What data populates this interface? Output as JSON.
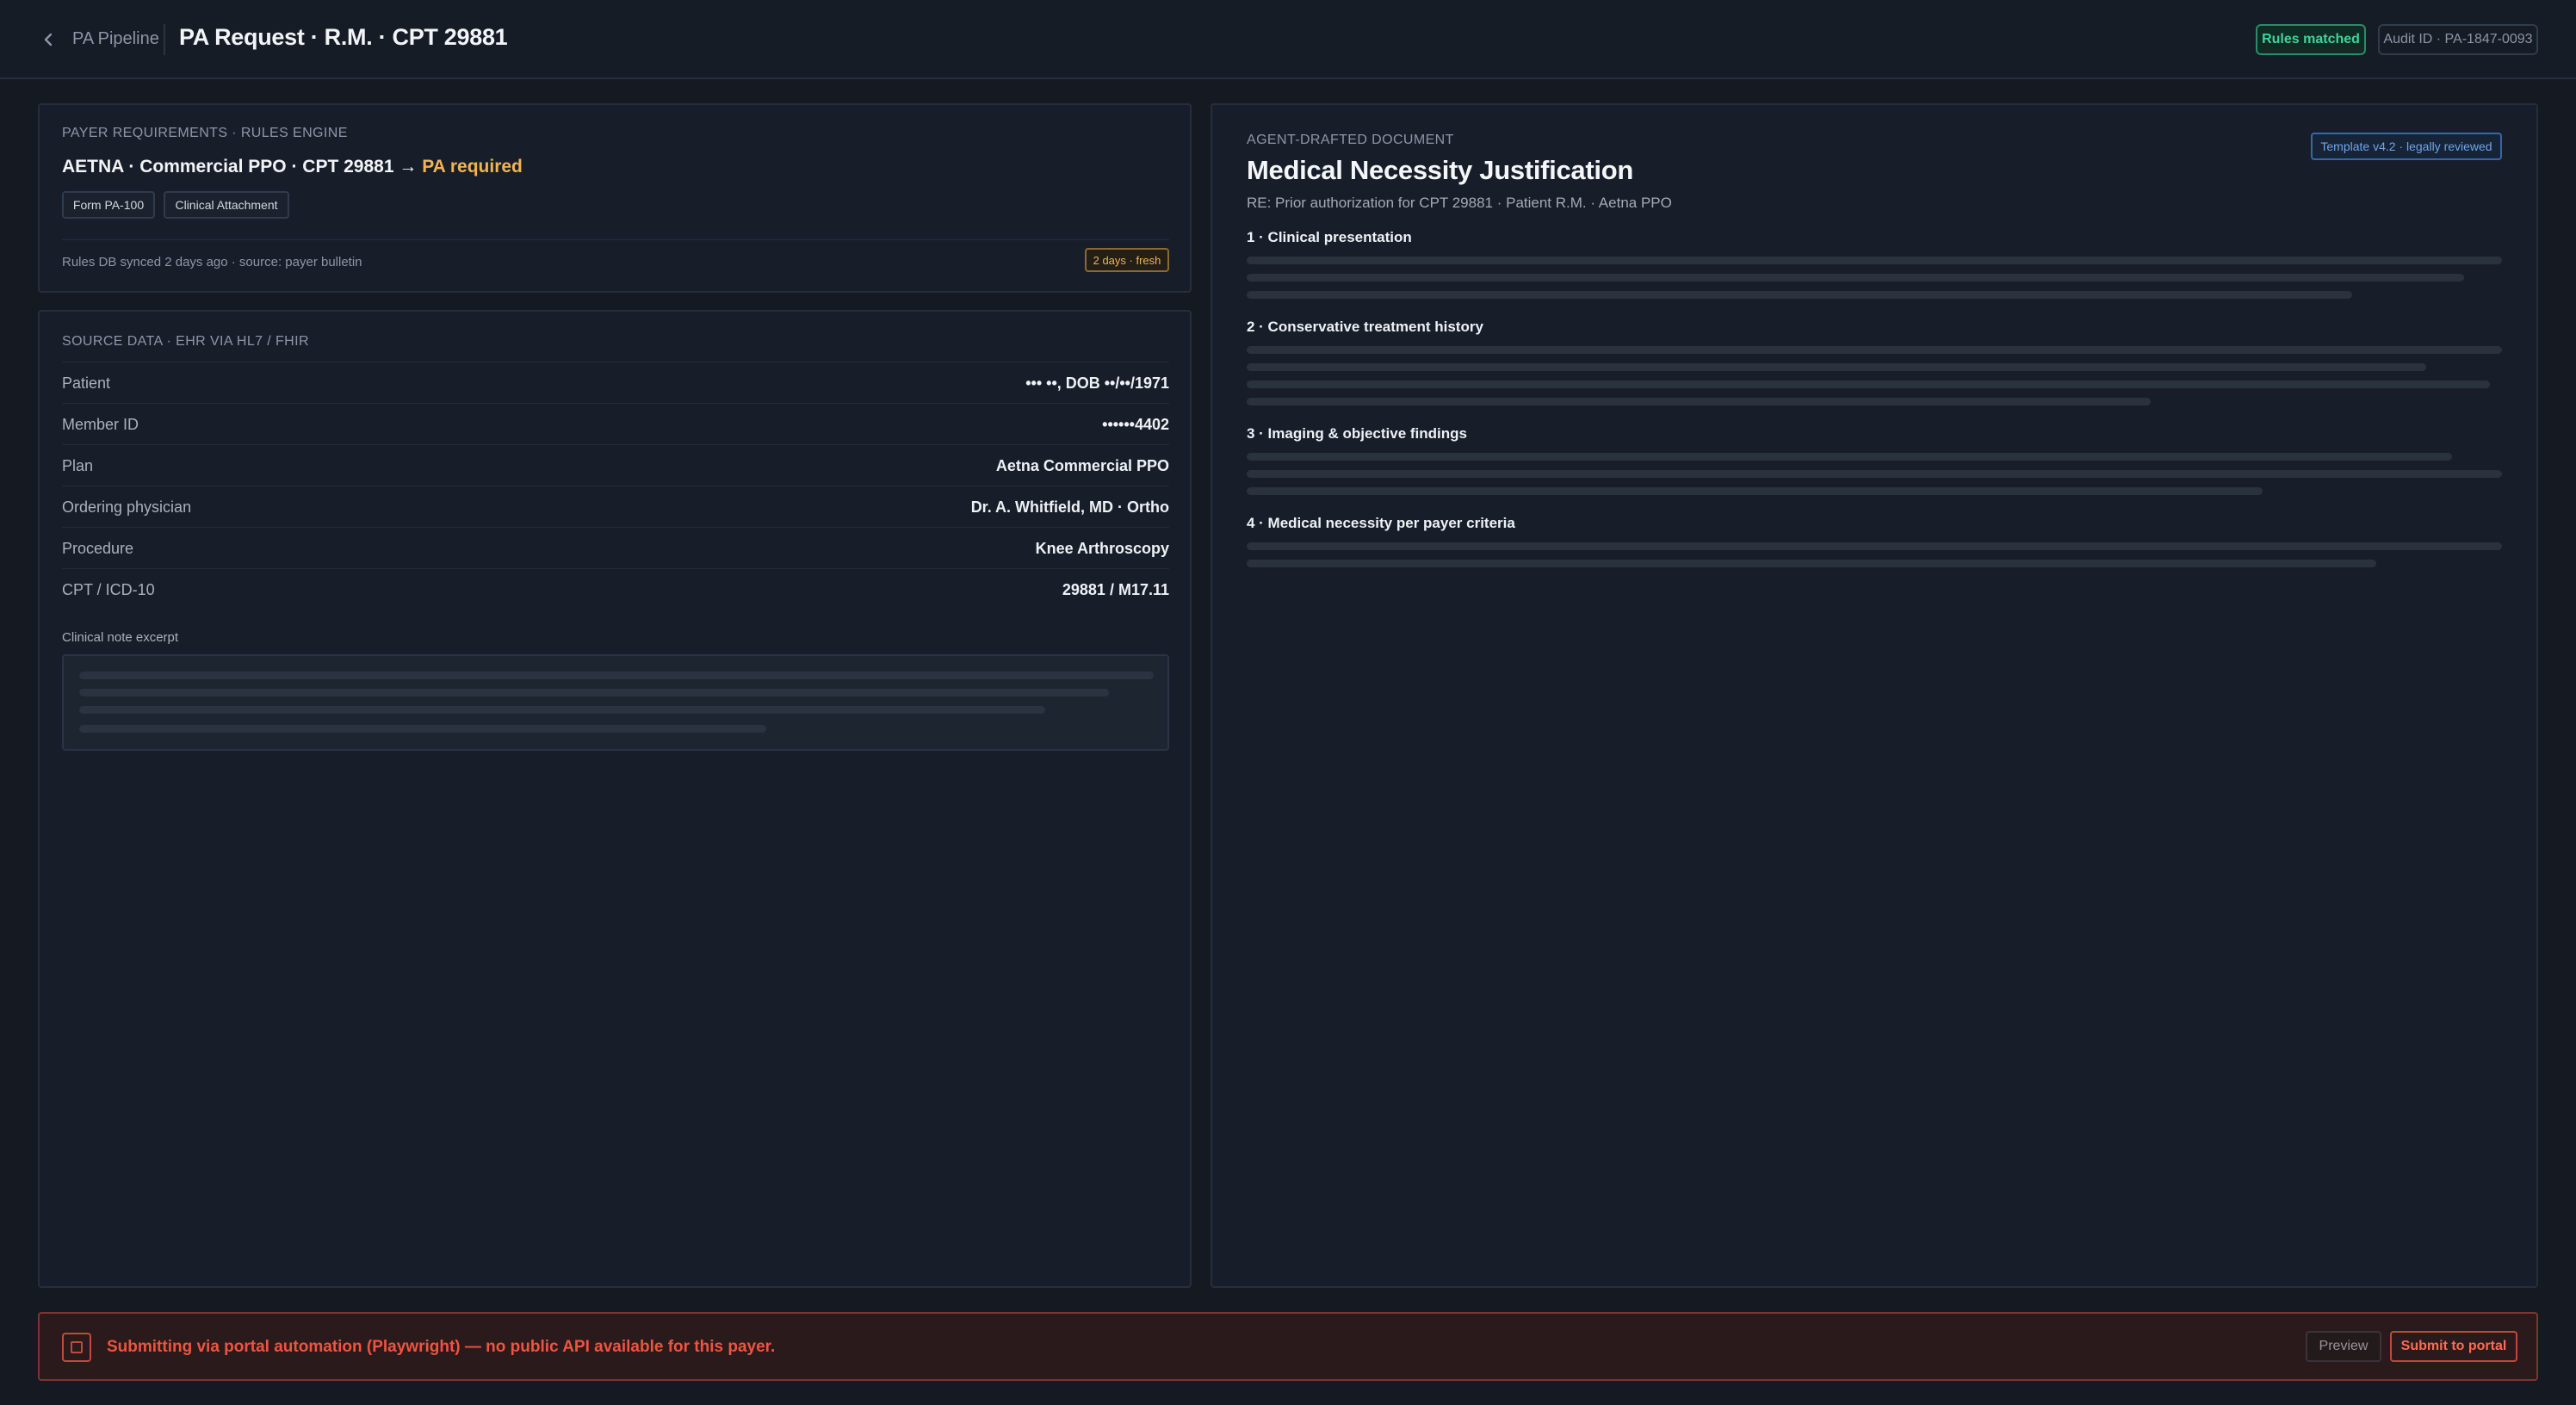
{
  "header": {
    "back_icon": "chevron-left-icon",
    "breadcrumb": "PA Pipeline",
    "title": "PA Request · R.M. · CPT 29881",
    "rules_badge": "Rules matched",
    "audit_badge": "Audit ID · PA-1847-0093"
  },
  "payer": {
    "eyebrow": "PAYER REQUIREMENTS · RULES ENGINE",
    "line_prefix": "AETNA · Commercial PPO · CPT 29881 →",
    "line_status": "PA required",
    "chips": [
      "Form PA-100",
      "Clinical Attachment"
    ],
    "sync_text": "Rules DB synced 2 days ago · source: payer bulletin",
    "fresh_badge": "2 days · fresh"
  },
  "source": {
    "eyebrow": "SOURCE DATA · EHR VIA HL7 / FHIR",
    "rows": [
      {
        "label": "Patient",
        "value": "••• ••, DOB ••/••/1971"
      },
      {
        "label": "Member ID",
        "value": "••••••4402"
      },
      {
        "label": "Plan",
        "value": "Aetna Commercial PPO"
      },
      {
        "label": "Ordering physician",
        "value": "Dr. A. Whitfield, MD · Ortho"
      },
      {
        "label": "Procedure",
        "value": "Knee Arthroscopy"
      },
      {
        "label": "CPT / ICD-10",
        "value": "29881 / M17.11"
      }
    ],
    "note_label": "Clinical note excerpt"
  },
  "document": {
    "eyebrow": "AGENT-DRAFTED DOCUMENT",
    "template_badge": "Template v4.2 · legally reviewed",
    "title": "Medical Necessity Justification",
    "subtitle": "RE: Prior authorization for CPT 29881 · Patient R.M. · Aetna PPO",
    "sections": [
      "1 · Clinical presentation",
      "2 · Conservative treatment history",
      "3 · Imaging & objective findings",
      "4 · Medical necessity per payer criteria"
    ]
  },
  "banner": {
    "text": "Submitting via portal automation (Playwright) — no public API available for this payer.",
    "preview_label": "Preview",
    "submit_label": "Submit to portal"
  },
  "colors": {
    "background": "#141922",
    "success": "#3fd49a",
    "warning": "#f0b454",
    "danger": "#f0533f",
    "info": "#6fa6ea"
  }
}
